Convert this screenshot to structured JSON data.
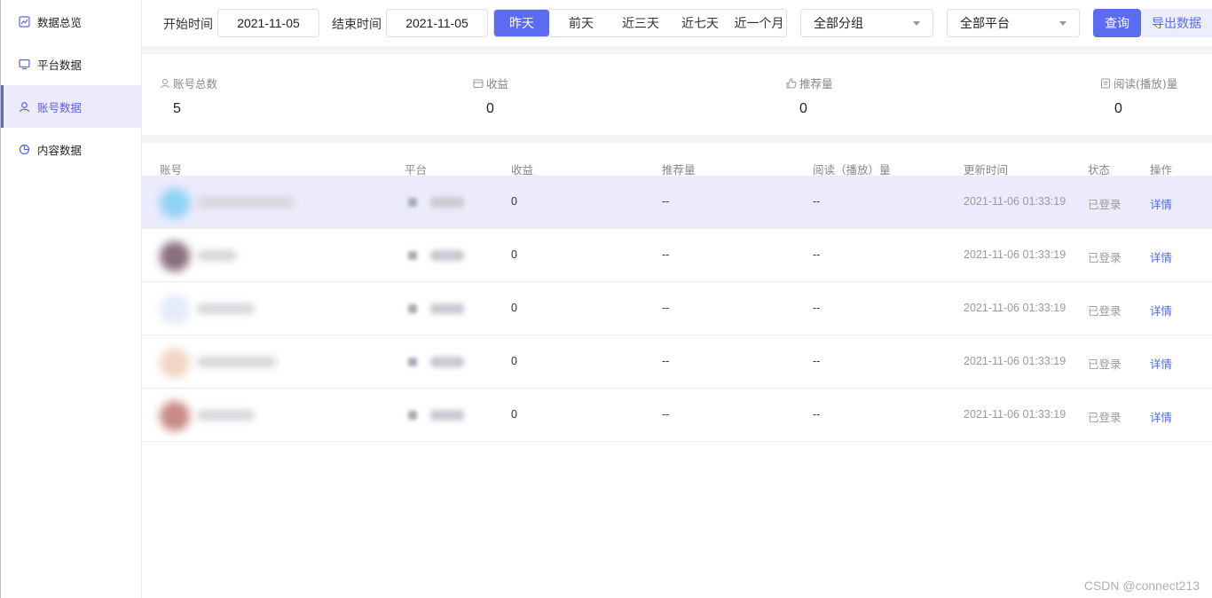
{
  "sidebar": {
    "items": [
      {
        "label": "数据总览",
        "icon": "line-chart-icon",
        "active": false
      },
      {
        "label": "平台数据",
        "icon": "monitor-icon",
        "active": false
      },
      {
        "label": "账号数据",
        "icon": "user-icon",
        "active": true
      },
      {
        "label": "内容数据",
        "icon": "pie-chart-icon",
        "active": false
      }
    ]
  },
  "toolbar": {
    "start_label": "开始时间",
    "start_value": "2021-11-05",
    "end_label": "结束时间",
    "end_value": "2021-11-05",
    "ranges": [
      "昨天",
      "前天",
      "近三天",
      "近七天",
      "近一个月"
    ],
    "active_range": "昨天",
    "group_select": "全部分组",
    "platform_select": "全部平台",
    "query_label": "查询",
    "export_label": "导出数据"
  },
  "stats": [
    {
      "label": "账号总数",
      "value": "5",
      "icon": "user-icon"
    },
    {
      "label": "收益",
      "value": "0",
      "icon": "wallet-icon"
    },
    {
      "label": "推荐量",
      "value": "0",
      "icon": "thumbs-up-icon"
    },
    {
      "label": "阅读(播放)量",
      "value": "0",
      "icon": "document-icon"
    }
  ],
  "table": {
    "headers": [
      "账号",
      "平台",
      "收益",
      "推荐量",
      "阅读（播放）量",
      "更新时间",
      "状态",
      "操作"
    ],
    "rows": [
      {
        "income": "0",
        "recommend": "--",
        "reads": "--",
        "updated": "2021-11-06 01:33:19",
        "status": "已登录",
        "action": "详情"
      },
      {
        "income": "0",
        "recommend": "--",
        "reads": "--",
        "updated": "2021-11-06 01:33:19",
        "status": "已登录",
        "action": "详情"
      },
      {
        "income": "0",
        "recommend": "--",
        "reads": "--",
        "updated": "2021-11-06 01:33:19",
        "status": "已登录",
        "action": "详情"
      },
      {
        "income": "0",
        "recommend": "--",
        "reads": "--",
        "updated": "2021-11-06 01:33:19",
        "status": "已登录",
        "action": "详情"
      },
      {
        "income": "0",
        "recommend": "--",
        "reads": "--",
        "updated": "2021-11-06 01:33:19",
        "status": "已登录",
        "action": "详情"
      }
    ]
  },
  "watermark": "CSDN @connect213",
  "colors": {
    "accent": "#5b6cf0",
    "active_bg": "#ebebfb",
    "link": "#4d6bdc"
  }
}
